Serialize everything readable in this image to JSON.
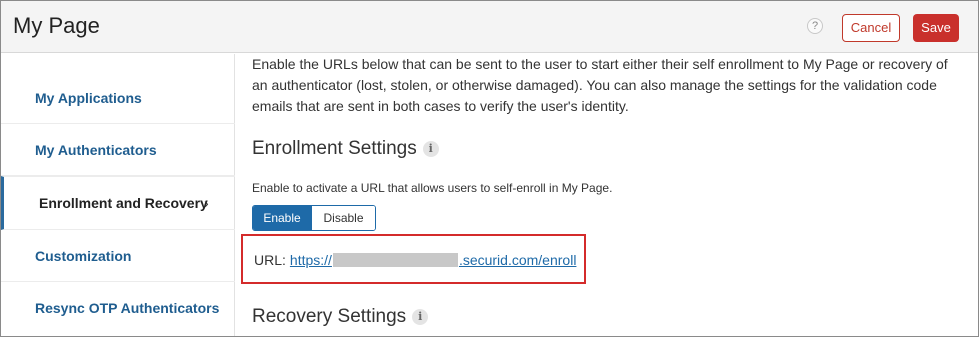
{
  "header": {
    "title": "My Page",
    "help_glyph": "?",
    "cancel_label": "Cancel",
    "save_label": "Save"
  },
  "sidebar": {
    "items": [
      {
        "label": "My Applications"
      },
      {
        "label": "My Authenticators"
      },
      {
        "label": "Enrollment and Recovery",
        "active": true,
        "chevron": "›"
      },
      {
        "label": "Customization"
      },
      {
        "label": "Resync OTP Authenticators"
      }
    ]
  },
  "main": {
    "intro": "Enable the URLs below that can be sent to the user to start either their self enrollment to My Page or recovery of an authenticator (lost, stolen, or otherwise damaged). You can also manage the settings for the validation code emails that are sent in both cases to verify the user's identity.",
    "enrollment": {
      "heading": "Enrollment Settings",
      "info_glyph": "i",
      "help_text": "Enable to activate a URL that allows users to self-enroll in My Page.",
      "toggle": {
        "enable_label": "Enable",
        "disable_label": "Disable",
        "selected": "Enable"
      },
      "url_label": "URL:",
      "url_prefix": "https://",
      "url_suffix": ".securid.com/enroll"
    },
    "recovery": {
      "heading": "Recovery Settings",
      "info_glyph": "i"
    }
  },
  "colors": {
    "accent": "#1e6aa8",
    "save": "#c9302c",
    "highlight_box": "#d42b2b",
    "nav_link": "#1f5d8f"
  }
}
